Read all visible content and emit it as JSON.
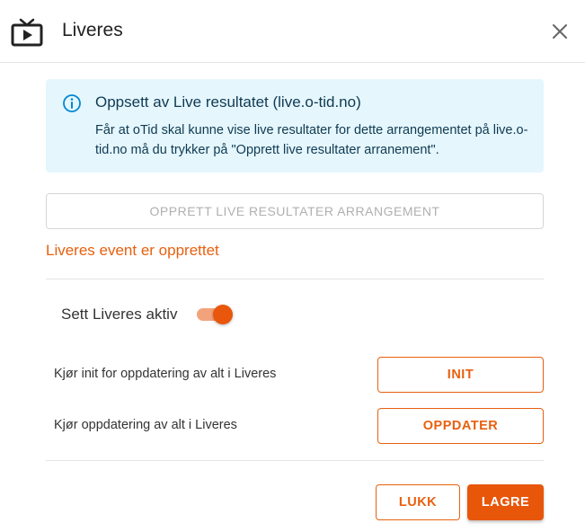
{
  "header": {
    "title": "Liveres",
    "icon": "live-tv-icon",
    "close_icon": "close-icon"
  },
  "info": {
    "icon": "info-icon",
    "title": "Oppsett av Live resultatet (live.o-tid.no)",
    "text": "Får at oTid skal kunne vise live resultater for dette arrangementet på live.o-tid.no må du trykker på \"Opprett live resultater arranement\"."
  },
  "create_button": {
    "label": "OPPRETT LIVE RESULTATER ARRANGEMENT",
    "disabled": true
  },
  "status": {
    "text": "Liveres event er opprettet"
  },
  "toggle": {
    "label": "Sett Liveres aktiv",
    "checked": true
  },
  "actions": {
    "init": {
      "description": "Kjør init for oppdatering av alt i Liveres",
      "button_label": "INIT"
    },
    "update": {
      "description": "Kjør oppdatering av alt i Liveres",
      "button_label": "OPPDATER"
    }
  },
  "footer": {
    "close_label": "LUKK",
    "save_label": "LAGRE"
  },
  "colors": {
    "accent": "#e8560a",
    "info_bg": "#e5f6fd",
    "info_text": "#0f3a52",
    "info_icon": "#0288d1"
  }
}
